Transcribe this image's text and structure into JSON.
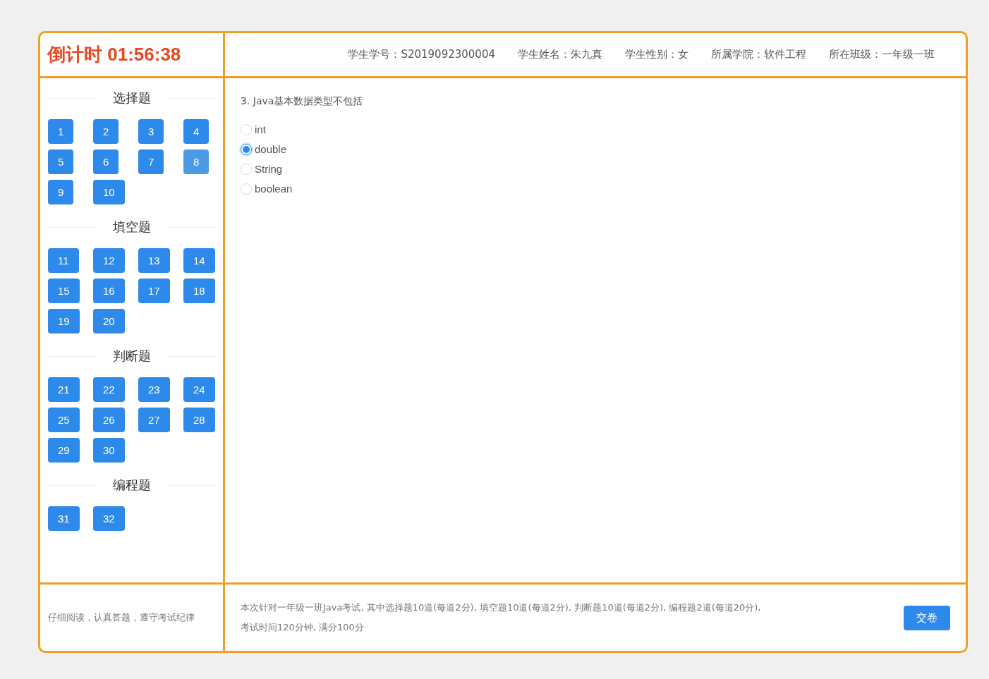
{
  "timer": {
    "label": "倒计时",
    "time": "01:56:38"
  },
  "student_info": [
    {
      "label": "学生学号：",
      "value": "S2019092300004"
    },
    {
      "label": "学生姓名：",
      "value": "朱九真"
    },
    {
      "label": "学生性别：",
      "value": "女"
    },
    {
      "label": "所属学院：",
      "value": "软件工程"
    },
    {
      "label": "所在班级：",
      "value": "一年级一班"
    }
  ],
  "sections": [
    {
      "title": "选择题",
      "questions": [
        {
          "number": "1",
          "hovered": false
        },
        {
          "number": "2",
          "hovered": false
        },
        {
          "number": "3",
          "hovered": false
        },
        {
          "number": "4",
          "hovered": false
        },
        {
          "number": "5",
          "hovered": false
        },
        {
          "number": "6",
          "hovered": false
        },
        {
          "number": "7",
          "hovered": false
        },
        {
          "number": "8",
          "hovered": true
        },
        {
          "number": "9",
          "hovered": false
        },
        {
          "number": "10",
          "hovered": false
        }
      ]
    },
    {
      "title": "填空题",
      "questions": [
        {
          "number": "11",
          "hovered": false
        },
        {
          "number": "12",
          "hovered": false
        },
        {
          "number": "13",
          "hovered": false
        },
        {
          "number": "14",
          "hovered": false
        },
        {
          "number": "15",
          "hovered": false
        },
        {
          "number": "16",
          "hovered": false
        },
        {
          "number": "17",
          "hovered": false
        },
        {
          "number": "18",
          "hovered": false
        },
        {
          "number": "19",
          "hovered": false
        },
        {
          "number": "20",
          "hovered": false
        }
      ]
    },
    {
      "title": "判断题",
      "questions": [
        {
          "number": "21",
          "hovered": false
        },
        {
          "number": "22",
          "hovered": false
        },
        {
          "number": "23",
          "hovered": false
        },
        {
          "number": "24",
          "hovered": false
        },
        {
          "number": "25",
          "hovered": false
        },
        {
          "number": "26",
          "hovered": false
        },
        {
          "number": "27",
          "hovered": false
        },
        {
          "number": "28",
          "hovered": false
        },
        {
          "number": "29",
          "hovered": false
        },
        {
          "number": "30",
          "hovered": false
        }
      ]
    },
    {
      "title": "编程题",
      "questions": [
        {
          "number": "31",
          "hovered": false
        },
        {
          "number": "32",
          "hovered": false
        }
      ]
    }
  ],
  "question": {
    "text": "3. Java基本数据类型不包括",
    "options": [
      {
        "label": "int",
        "selected": false
      },
      {
        "label": "double",
        "selected": true
      },
      {
        "label": "String",
        "selected": false
      },
      {
        "label": "boolean",
        "selected": false
      }
    ]
  },
  "footer": {
    "reminder": "仔细阅读，认真答题，遵守考试纪律",
    "description": "本次针对一年级一班Java考试, 其中选择题10道(每道2分), 填空题10道(每道2分), 判断题10道(每道2分), 编程题2道(每道20分), 考试时间120分钟, 满分100分",
    "submit_button": "交卷"
  }
}
